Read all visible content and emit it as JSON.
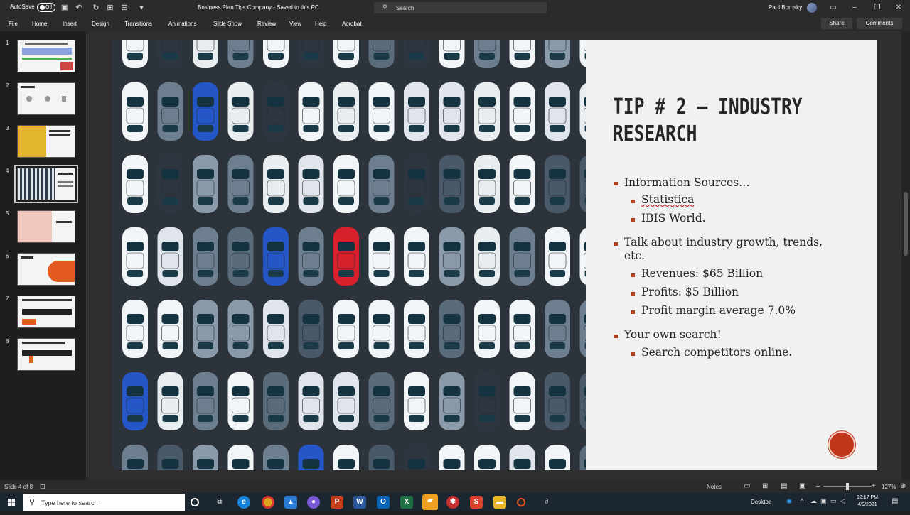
{
  "titlebar": {
    "autosave_label": "AutoSave",
    "autosave_state": "Off",
    "document_title": "Business Plan Tips Company  -  Saved to this PC",
    "search_placeholder": "Search",
    "user_name": "Paul Borosky"
  },
  "menu": {
    "items": [
      "File",
      "Home",
      "Insert",
      "Design",
      "Transitions",
      "Animations",
      "Slide Show",
      "Review",
      "View",
      "Help",
      "Acrobat"
    ],
    "share_label": "Share",
    "comments_label": "Comments"
  },
  "thumbnails": {
    "numbers": [
      "1",
      "2",
      "3",
      "4",
      "5",
      "6",
      "7",
      "8"
    ],
    "active_index": 4
  },
  "slide": {
    "title_line1": "TIP # 2 – INDUSTRY",
    "title_line2": "RESEARCH",
    "bullet_1": "Information Sources…",
    "bullet_1a": "Statistica",
    "bullet_1b": "IBIS World.",
    "bullet_2_line1": "Talk about industry growth, trends,",
    "bullet_2_line2": "etc.",
    "bullet_2a": "Revenues: $65 Billion",
    "bullet_2b": "Profits: $5 Billion",
    "bullet_2c": "Profit margin average 7.0%",
    "bullet_3": "Your own search!",
    "bullet_3a": "Search competitors online.",
    "accent_color": "#b23b1c"
  },
  "status": {
    "slide_count": "Slide 4 of 8",
    "notes_label": "Notes",
    "zoom_level": "127%"
  },
  "taskbar": {
    "search_placeholder": "Type here to search",
    "desktop_label": "Desktop",
    "time": "12:17 PM",
    "date": "4/9/2021"
  }
}
